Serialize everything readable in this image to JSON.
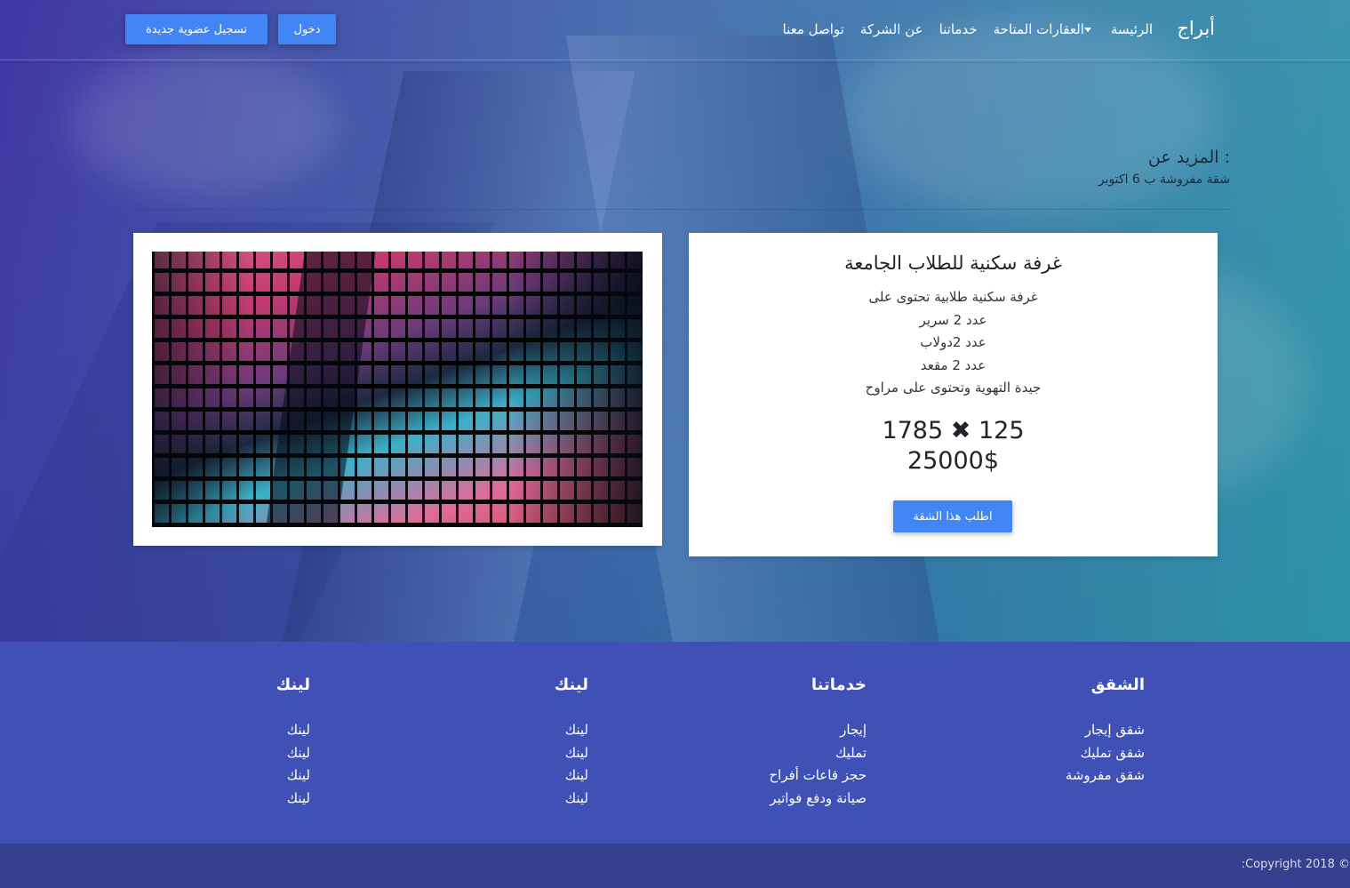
{
  "navbar": {
    "brand": "أبراج",
    "links": [
      "الرئيسة",
      "العقارات المتاحة",
      "خدماتنا",
      "عن الشركة",
      "تواصل معنا"
    ],
    "login_label": "دخول",
    "register_label": "تسجيل عضوية جديدة"
  },
  "section": {
    "heading": "المزيد عن :",
    "subheading": "شقة مفروشة ب 6 اكتوبر"
  },
  "listing": {
    "title": "غرفة سكنية للطلاب الجامعة",
    "description": [
      "غرفة سكنية طلابية تحتوى على",
      "عدد 2 سرير",
      "عدد 2دولاب",
      "عدد 2 مقعد",
      "جيدة التهوية وتحتوى على مراوح"
    ],
    "dim_a": "125",
    "dim_b": "1785",
    "dim_separator": "✖",
    "price": "25000$",
    "request_label": "اطلب هذا الشقة"
  },
  "footer": {
    "columns": [
      {
        "heading": "الشقق",
        "links": [
          "شقق إيجار",
          "شقق تمليك",
          "شقق مفروشة"
        ]
      },
      {
        "heading": "خدماتنا",
        "links": [
          "إيجار",
          "تمليك",
          "حجز قاعات أفراح",
          "صيانة ودفع فواتير"
        ]
      },
      {
        "heading": "لينك",
        "links": [
          "لينك",
          "لينك",
          "لينك",
          "لينك"
        ]
      },
      {
        "heading": "لينك",
        "links": [
          "لينك",
          "لينك",
          "لينك",
          "لينك"
        ]
      }
    ],
    "copyright": "© Copyright 2018:"
  },
  "colors": {
    "primary_button": "#4285f4",
    "footer_bg": "#3f51b5",
    "copyright_bg": "#32408f"
  }
}
